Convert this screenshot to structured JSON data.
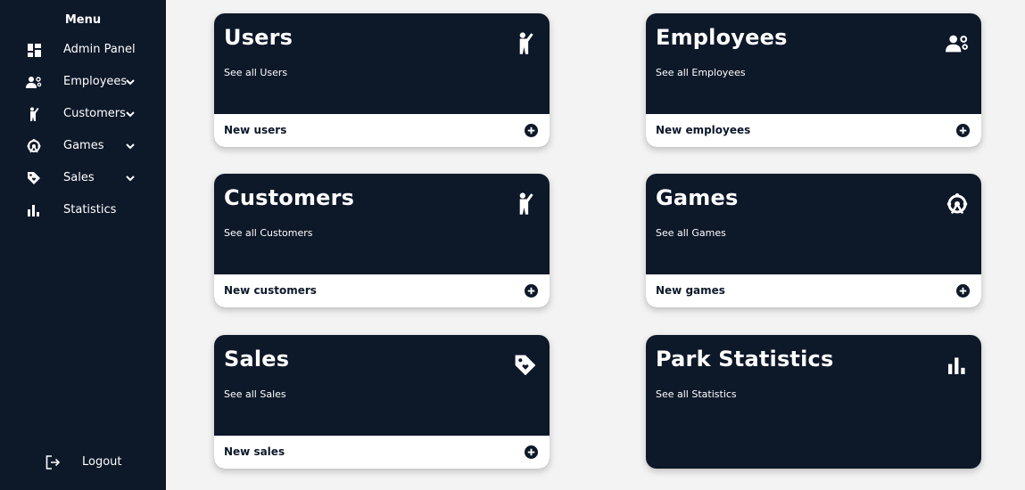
{
  "sidebar": {
    "title": "Menu",
    "items": [
      {
        "label": "Admin Panel",
        "icon": "dashboard-icon"
      },
      {
        "label": "Employees",
        "icon": "employee-icon",
        "expandable": true
      },
      {
        "label": "Customers",
        "icon": "person-icon",
        "expandable": true
      },
      {
        "label": "Games",
        "icon": "ferris-wheel-icon",
        "expandable": true
      },
      {
        "label": "Sales",
        "icon": "tag-icon",
        "expandable": true
      },
      {
        "label": "Statistics",
        "icon": "bar-chart-icon"
      }
    ],
    "logout": {
      "label": "Logout",
      "icon": "logout-icon"
    }
  },
  "cards": [
    {
      "title": "Users",
      "subtitle": "See all Users",
      "footer": "New users",
      "icon": "person-icon"
    },
    {
      "title": "Employees",
      "subtitle": "See all Employees",
      "footer": "New employees",
      "icon": "employee-icon"
    },
    {
      "title": "Customers",
      "subtitle": "See all Customers",
      "footer": "New customers",
      "icon": "person-icon"
    },
    {
      "title": "Games",
      "subtitle": "See all Games",
      "footer": "New games",
      "icon": "ferris-wheel-icon"
    },
    {
      "title": "Sales",
      "subtitle": "See all Sales",
      "footer": "New sales",
      "icon": "tag-icon"
    },
    {
      "title": "Park Statistics",
      "subtitle": "See all Statistics",
      "icon": "bar-chart-icon"
    }
  ],
  "colors": {
    "navy": "#0d1829",
    "background": "#f3f3f3",
    "white": "#ffffff"
  }
}
